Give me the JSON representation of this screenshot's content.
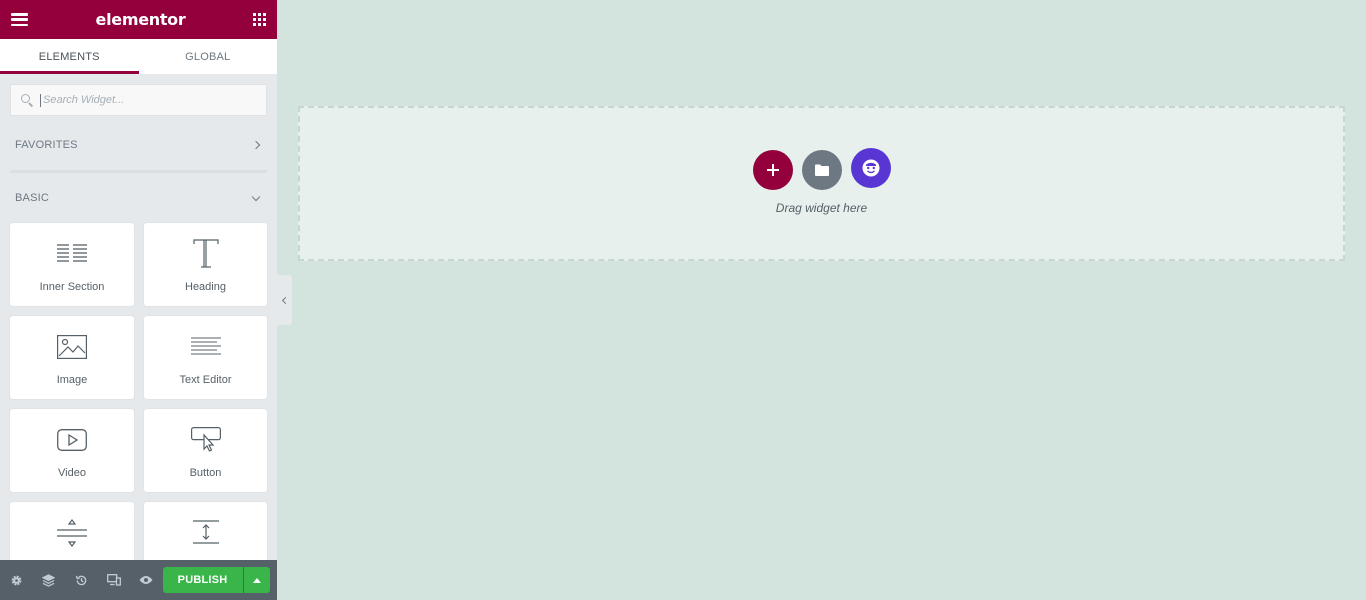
{
  "header": {
    "logo": "elementor",
    "menu_icon": "hamburger-icon",
    "apps_icon": "apps-grid-icon"
  },
  "tabs": [
    {
      "label": "ELEMENTS",
      "active": true
    },
    {
      "label": "GLOBAL",
      "active": false
    }
  ],
  "search": {
    "placeholder": "Search Widget...",
    "icon": "search-icon"
  },
  "categories": {
    "favorites": {
      "label": "FAVORITES",
      "icon": "chevron-right-icon"
    },
    "basic": {
      "label": "BASIC",
      "icon": "chevron-down-icon"
    }
  },
  "widgets": [
    {
      "label": "Inner Section",
      "icon": "inner-section-icon"
    },
    {
      "label": "Heading",
      "icon": "heading-icon"
    },
    {
      "label": "Image",
      "icon": "image-icon"
    },
    {
      "label": "Text Editor",
      "icon": "text-editor-icon"
    },
    {
      "label": "Video",
      "icon": "video-icon"
    },
    {
      "label": "Button",
      "icon": "button-icon"
    },
    {
      "label": "",
      "icon": "divider-icon"
    },
    {
      "label": "",
      "icon": "spacer-icon"
    }
  ],
  "footer": {
    "tools": [
      "settings-icon",
      "navigator-icon",
      "history-icon",
      "responsive-icon",
      "preview-icon"
    ],
    "publish_label": "PUBLISH",
    "publish_options_icon": "caret-up-icon"
  },
  "canvas": {
    "drop_text": "Drag widget here",
    "buttons": [
      "add-section-icon",
      "add-template-icon",
      "elementor-kit-icon"
    ]
  },
  "colors": {
    "brand": "#93003c",
    "publish": "#39b54a",
    "canvas_bg": "#d3e4de",
    "kit_purple": "#5936d4",
    "footer_bg": "#556068"
  }
}
